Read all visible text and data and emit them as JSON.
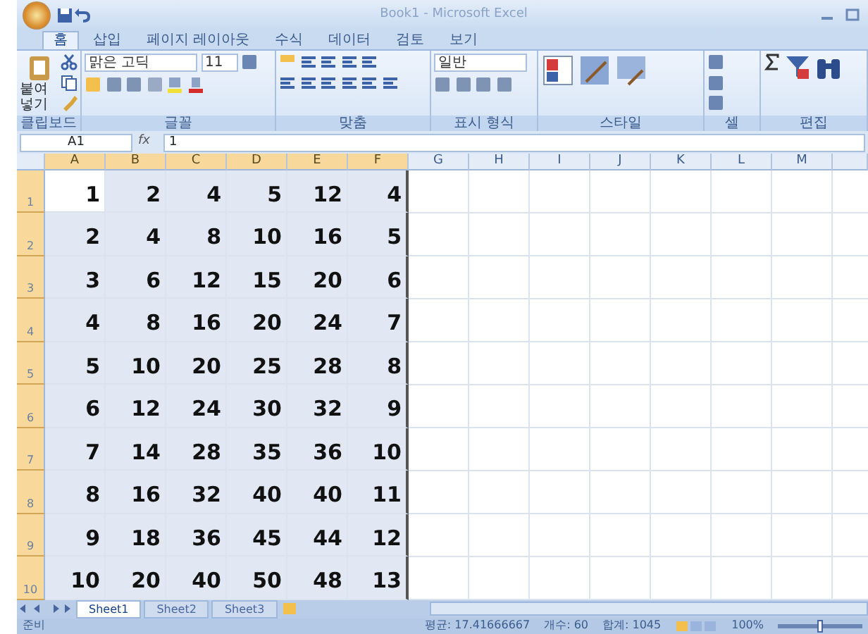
{
  "title_bar": {
    "title": "Book1 - Microsoft Excel"
  },
  "ribbon_tabs": [
    {
      "label": "홈",
      "selected": true
    },
    {
      "label": "삽입",
      "selected": false
    },
    {
      "label": "페이지 레이아웃",
      "selected": false
    },
    {
      "label": "수식",
      "selected": false
    },
    {
      "label": "데이터",
      "selected": false
    },
    {
      "label": "검토",
      "selected": false
    },
    {
      "label": "보기",
      "selected": false
    }
  ],
  "ribbon": {
    "paste_label": "붙여넣기",
    "font_name": "맑은 고딕",
    "font_size": "11",
    "number_format": "일반"
  },
  "ribbon_groups": [
    {
      "label": "클립보드"
    },
    {
      "label": "글꼴"
    },
    {
      "label": "맞춤"
    },
    {
      "label": "표시 형식"
    },
    {
      "label": "스타일"
    },
    {
      "label": "셀"
    },
    {
      "label": "편집"
    }
  ],
  "formula_bar": {
    "name_box": "A1",
    "fx": "fx",
    "value": "1"
  },
  "columns": [
    {
      "label": "A",
      "selected": true
    },
    {
      "label": "B",
      "selected": true
    },
    {
      "label": "C",
      "selected": true
    },
    {
      "label": "D",
      "selected": true
    },
    {
      "label": "E",
      "selected": true
    },
    {
      "label": "F",
      "selected": true
    },
    {
      "label": "G",
      "selected": false
    },
    {
      "label": "H",
      "selected": false
    },
    {
      "label": "I",
      "selected": false
    },
    {
      "label": "J",
      "selected": false
    },
    {
      "label": "K",
      "selected": false
    },
    {
      "label": "L",
      "selected": false
    },
    {
      "label": "M",
      "selected": false
    }
  ],
  "rows": [
    {
      "header": "1",
      "selected": true,
      "cells": [
        "1",
        "2",
        "4",
        "5",
        "12",
        "4"
      ]
    },
    {
      "header": "2",
      "selected": true,
      "cells": [
        "2",
        "4",
        "8",
        "10",
        "16",
        "5"
      ]
    },
    {
      "header": "3",
      "selected": true,
      "cells": [
        "3",
        "6",
        "12",
        "15",
        "20",
        "6"
      ]
    },
    {
      "header": "4",
      "selected": true,
      "cells": [
        "4",
        "8",
        "16",
        "20",
        "24",
        "7"
      ]
    },
    {
      "header": "5",
      "selected": true,
      "cells": [
        "5",
        "10",
        "20",
        "25",
        "28",
        "8"
      ]
    },
    {
      "header": "6",
      "selected": true,
      "cells": [
        "6",
        "12",
        "24",
        "30",
        "32",
        "9"
      ]
    },
    {
      "header": "7",
      "selected": true,
      "cells": [
        "7",
        "14",
        "28",
        "35",
        "36",
        "10"
      ]
    },
    {
      "header": "8",
      "selected": true,
      "cells": [
        "8",
        "16",
        "32",
        "40",
        "40",
        "11"
      ]
    },
    {
      "header": "9",
      "selected": true,
      "cells": [
        "9",
        "18",
        "36",
        "45",
        "44",
        "12"
      ]
    },
    {
      "header": "10",
      "selected": true,
      "cells": [
        "10",
        "20",
        "40",
        "50",
        "48",
        "13"
      ]
    }
  ],
  "sheet_tabs": [
    {
      "label": "Sheet1",
      "selected": true
    },
    {
      "label": "Sheet2",
      "selected": false
    },
    {
      "label": "Sheet3",
      "selected": false
    }
  ],
  "status_bar": {
    "mode": "준비",
    "average": "평균: 17.41666667",
    "count": "개수: 60",
    "sum": "합계: 1045",
    "zoom": "100%",
    "zoom_slider": {
      "level": 0.5
    }
  }
}
